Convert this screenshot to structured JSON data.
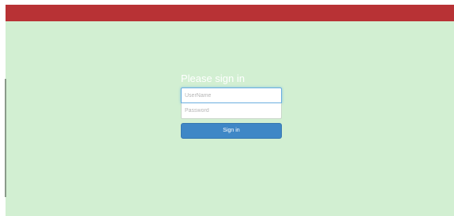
{
  "colors": {
    "header": "#b83235",
    "background": "#d2efd2",
    "primary_button": "#3f87c6",
    "focus_border": "#6aaee0"
  },
  "login": {
    "heading": "Please sign in",
    "username_placeholder": "UserName",
    "password_placeholder": "Password",
    "submit_label": "Sign in"
  }
}
